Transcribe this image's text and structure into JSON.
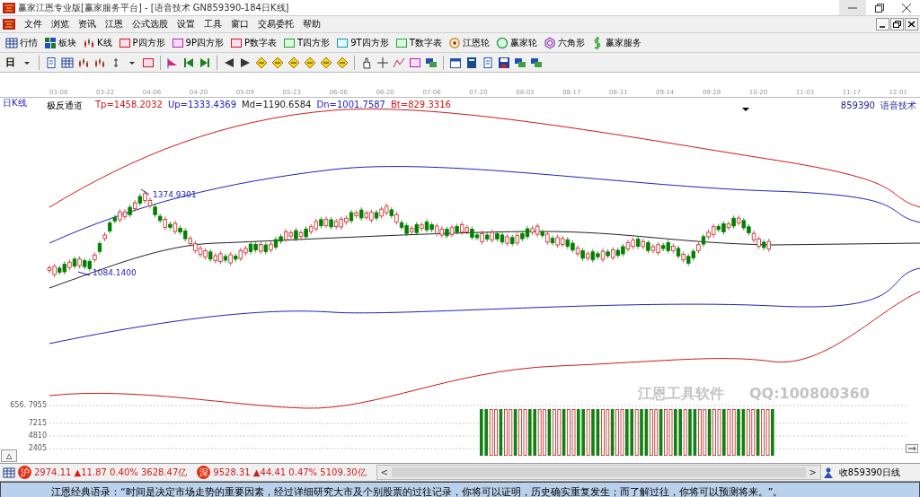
{
  "window": {
    "title": "赢家江恩专业版[赢家服务平台] - [语音技术  GN859390-184日K线]"
  },
  "menu": [
    "文件",
    "浏览",
    "资讯",
    "江恩",
    "公式选股",
    "设置",
    "工具",
    "窗口",
    "交易委托",
    "帮助"
  ],
  "toolbar": [
    {
      "label": "行情"
    },
    {
      "label": "板块"
    },
    {
      "label": "K线"
    },
    {
      "label": "P四方形"
    },
    {
      "label": "9P四方形"
    },
    {
      "label": "P数字表"
    },
    {
      "label": "T四方形"
    },
    {
      "label": "9T四方形"
    },
    {
      "label": "T数字表"
    },
    {
      "label": "江恩轮"
    },
    {
      "label": "赢家轮"
    },
    {
      "label": "六角形"
    },
    {
      "label": "赢家服务"
    }
  ],
  "period_button": "日",
  "dates": [
    "03-08",
    "03-22",
    "04-06",
    "04-20",
    "05-09",
    "05-23",
    "06-06",
    "06-20",
    "07-06",
    "07-20",
    "08-03",
    "08-17",
    "08-31",
    "09-14",
    "09-28",
    "10-20",
    "11-03",
    "11-17",
    "12-01"
  ],
  "chart": {
    "period_label": "日K线",
    "indicator": "极反通道",
    "values": [
      {
        "text": "Tp=1458.2032",
        "color": "#d01818"
      },
      {
        "text": "Up=1333.4369",
        "color": "#2020c0"
      },
      {
        "text": "Md=1190.6584",
        "color": "#202020"
      },
      {
        "text": "Dn=1001.7587",
        "color": "#2020c0"
      },
      {
        "text": "Bt=829.3316",
        "color": "#d01818"
      }
    ],
    "code": "859390",
    "name": "语音技术",
    "high_label": "1374.9301",
    "low_label": "1084.1400",
    "price_axis": "656. 7955",
    "volume_axis": [
      "7215",
      "4810",
      "2405"
    ],
    "overlay": [
      "江恩工具软件",
      "QQ:100800360"
    ],
    "collapse_button": "△"
  },
  "status_bar": {
    "indices": [
      {
        "badge": "沪",
        "text": "2974.11 ▲11.87 0.40% 3628.47亿"
      },
      {
        "badge": "深",
        "text": "9528.31 ▲44.41 0.47% 5109.30亿"
      }
    ],
    "scroll_left": "<",
    "scroll_right": ">",
    "right_text": "收859390日线"
  },
  "marquee": "江恩经典语录：“时间是决定市场走势的重要因素，经过详细研究大市及个别股票的过往记录，你将可以证明，历史确实重复发生；而了解过往，你将可以预测将来。”。"
}
